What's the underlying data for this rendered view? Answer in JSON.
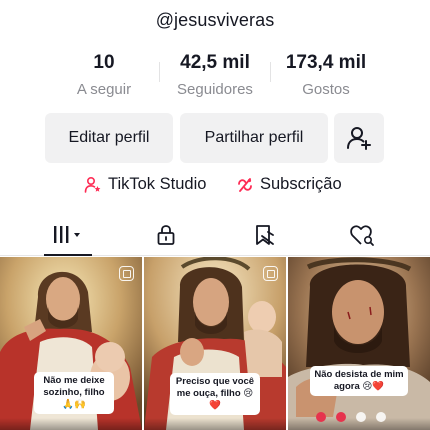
{
  "profile": {
    "username": "@jesusviveras"
  },
  "stats": [
    {
      "value": "10",
      "label": "A seguir"
    },
    {
      "value": "42,5 mil",
      "label": "Seguidores"
    },
    {
      "value": "173,4 mil",
      "label": "Gostos"
    }
  ],
  "actions": {
    "edit_profile": "Editar perfil",
    "share_profile": "Partilhar perfil",
    "add_friend_icon": "person-plus-icon"
  },
  "links": {
    "studio": "TikTok Studio",
    "subscription": "Subscrição"
  },
  "tabs": [
    {
      "icon": "videos-grid-icon",
      "active": true
    },
    {
      "icon": "lock-icon",
      "active": false
    },
    {
      "icon": "bookmark-icon",
      "active": false
    },
    {
      "icon": "liked-heart-icon",
      "active": false
    }
  ],
  "videos": [
    {
      "caption_line1": "Não me deixe",
      "caption_line2": "sozinho, filho 🙏🙌"
    },
    {
      "caption_line1": "Preciso que você",
      "caption_line2": "me ouça, filho 😢❤️"
    },
    {
      "caption_line1": "Não desista de mim",
      "caption_line2": "agora 😢❤️"
    }
  ],
  "colors": {
    "text": "#161823",
    "muted": "#8a8b91",
    "button_bg": "#f1f1f2",
    "accent": "#fe2c55"
  }
}
